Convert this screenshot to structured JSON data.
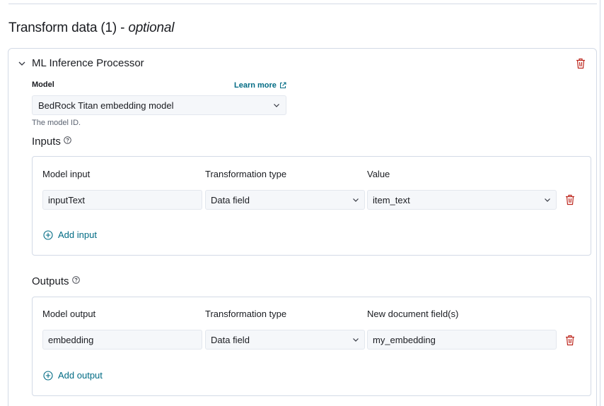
{
  "section": {
    "title": "Transform data (1)",
    "separator": " - ",
    "optional_label": "optional"
  },
  "processor": {
    "title": "ML Inference Processor",
    "model": {
      "label": "Model",
      "learn_more": "Learn more",
      "selected": "BedRock Titan embedding model",
      "help": "The model ID."
    },
    "inputs": {
      "title": "Inputs",
      "columns": [
        "Model input",
        "Transformation type",
        "Value"
      ],
      "rows": [
        {
          "model_input": "inputText",
          "transformation_type": "Data field",
          "value": "item_text"
        }
      ],
      "add_label": "Add input"
    },
    "outputs": {
      "title": "Outputs",
      "columns": [
        "Model output",
        "Transformation type",
        "New document field(s)"
      ],
      "rows": [
        {
          "model_output": "embedding",
          "transformation_type": "Data field",
          "value": "my_embedding"
        }
      ],
      "add_label": "Add output"
    }
  },
  "icons": {
    "collapse": "chevron-down-icon",
    "delete": "trash-icon",
    "external": "external-link-icon",
    "help": "question-circle-icon",
    "add": "plus-circle-icon"
  },
  "colors": {
    "link": "#006b84",
    "danger": "#bd271e",
    "border": "#d3dae6",
    "field_bg": "#f5f7fa"
  }
}
